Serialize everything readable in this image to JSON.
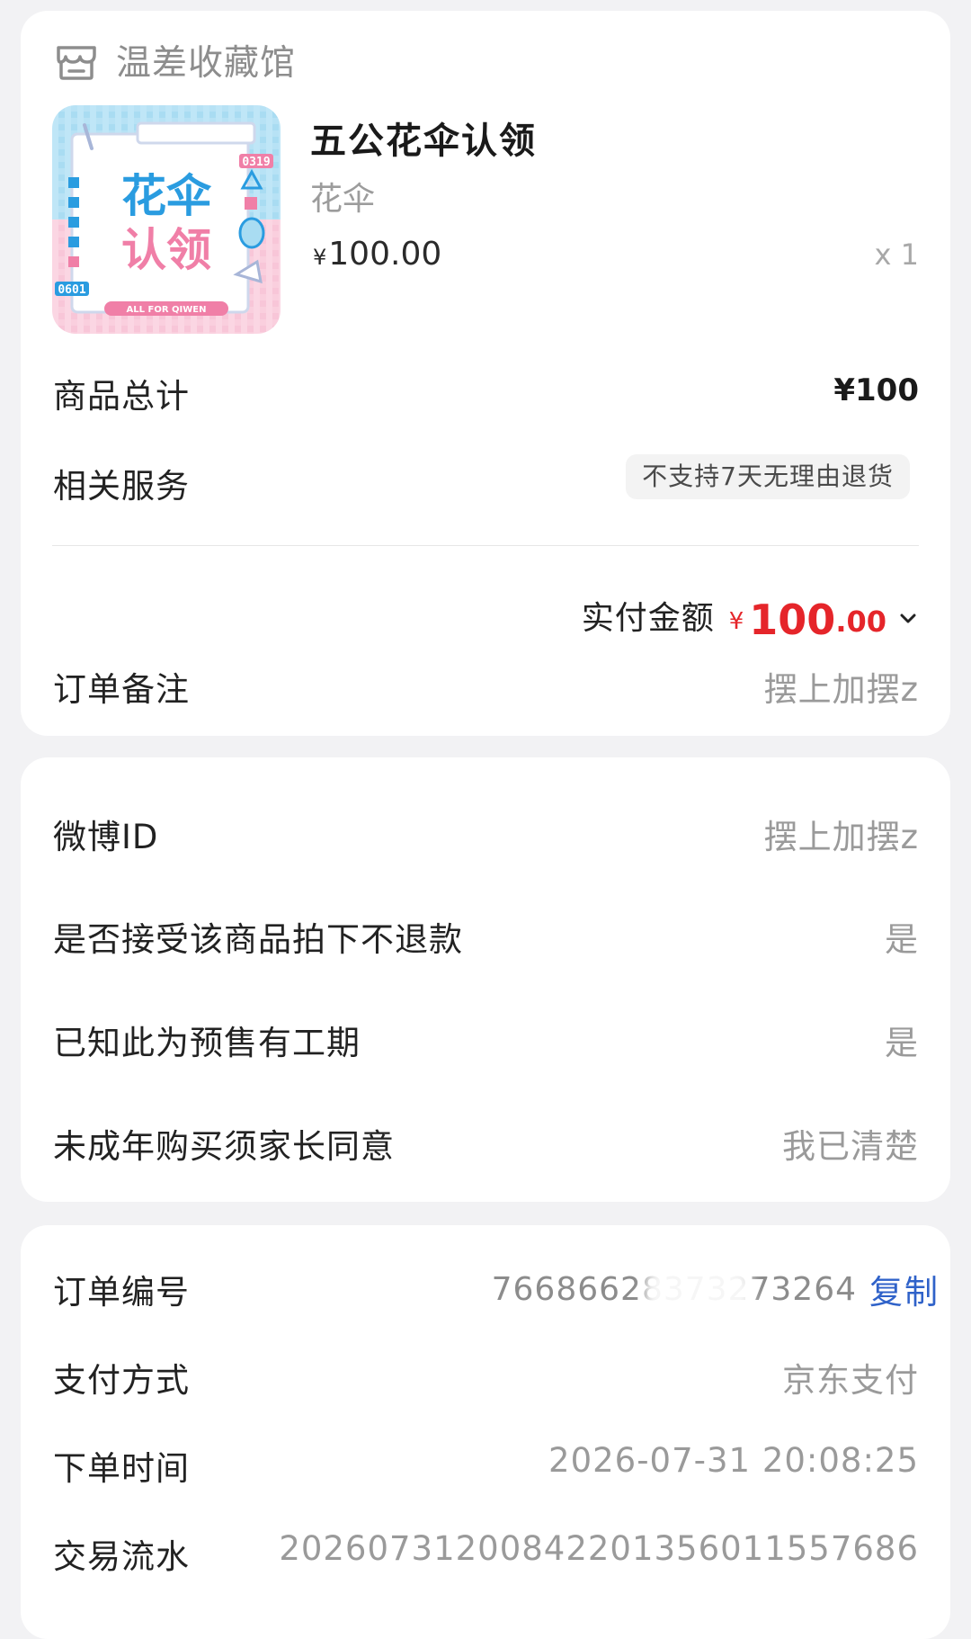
{
  "shop": {
    "name": "温差收藏馆",
    "icon": "store-icon"
  },
  "product": {
    "title": "五公花伞认领",
    "spec": "花伞",
    "currency": "¥",
    "price": "100.00",
    "qty": "x 1",
    "image": {
      "main_text_1": "花伞",
      "main_text_2": "认领",
      "tag_top": "0319",
      "tag_bottom": "0601",
      "footer": "ALL FOR QIWEN"
    }
  },
  "summary": {
    "total_label": "商品总计",
    "total_value": "¥100",
    "service_label": "相关服务",
    "service_badge": "不支持7天无理由退货",
    "paid_label": "实付金额",
    "paid_currency": "¥",
    "paid_int": "100",
    "paid_dec": ".00",
    "remark_label": "订单备注",
    "remark_value": "摆上加摆z"
  },
  "form": {
    "weibo_label": "微博ID",
    "weibo_value": "摆上加摆z",
    "norefund_label": "是否接受该商品拍下不退款",
    "norefund_value": "是",
    "presale_label": "已知此为预售有工期",
    "presale_value": "是",
    "minor_label": "未成年购买须家长同意",
    "minor_value": "我已清楚"
  },
  "order": {
    "no_label": "订单编号",
    "no_value": "76686628373273264",
    "copy_label": "复制",
    "pay_label": "支付方式",
    "pay_value": "京东支付",
    "time_label": "下单时间",
    "time_value": "2026-07-31 20:08:25",
    "serial_label": "交易流水",
    "serial_value": "20260731200842201356011557686"
  },
  "colors": {
    "accent_red": "#e5252a",
    "link_blue": "#2f62c9",
    "bg": "#f2f2f4"
  }
}
